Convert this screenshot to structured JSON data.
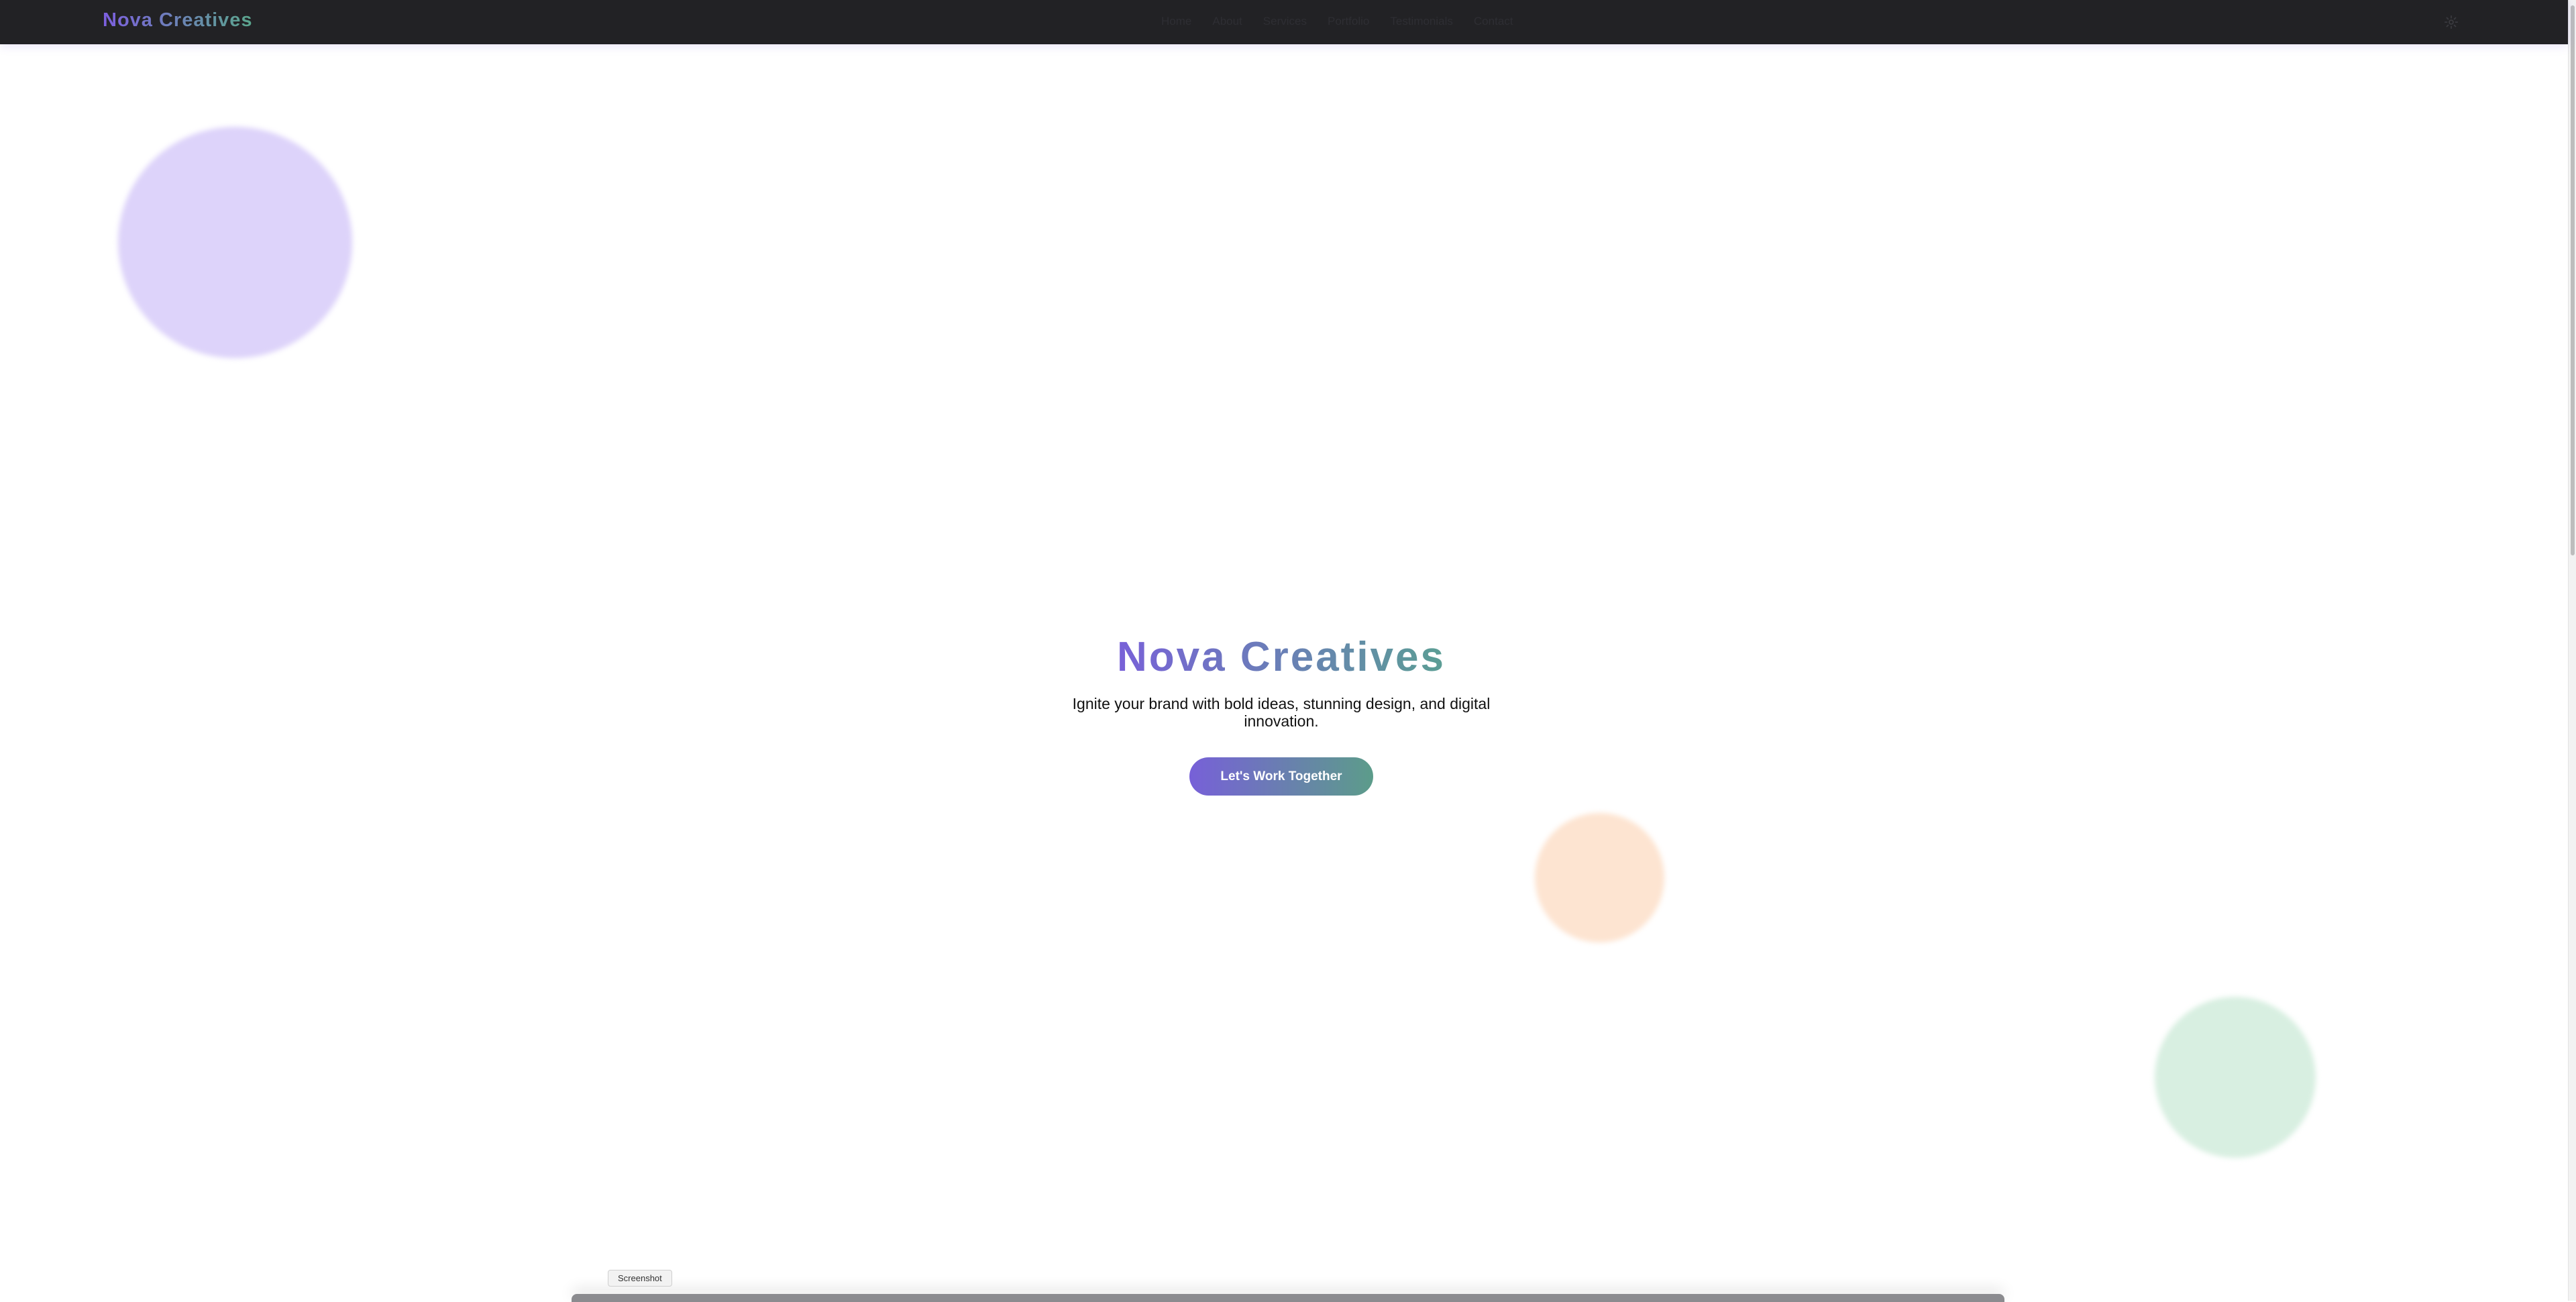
{
  "header": {
    "brand": "Nova Creatives",
    "nav": [
      "Home",
      "About",
      "Services",
      "Portfolio",
      "Testimonials",
      "Contact"
    ],
    "theme_icon": "gear-icon"
  },
  "hero": {
    "title": "Nova Creatives",
    "tagline": "Ignite your brand with bold ideas, stunning design, and digital innovation.",
    "cta_label": "Let's Work Together"
  },
  "overlay": {
    "tooltip": "Screenshot"
  },
  "colors": {
    "nav_bg": "#222225",
    "accent_purple": "#7760d8",
    "accent_green": "#5c9c8a",
    "blob_purple": "#ddd3fa",
    "blob_orange": "#fde4d1",
    "blob_green": "#d8efe1"
  }
}
